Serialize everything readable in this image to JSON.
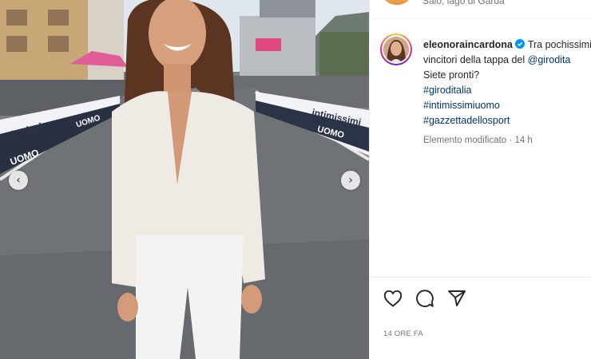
{
  "post": {
    "location": "Salò, lago di Garda",
    "username": "eleonoraincardona",
    "caption_text": "Tra pochissimi vincitori della tappa del",
    "mention": "@girodita",
    "caption_line2": "Siete pronti?",
    "hashtags": [
      "#giroditalia",
      "#intimissimiuomo",
      "#gazzettadellosport"
    ],
    "edited_label": "Elemento modificato",
    "edited_time": "14 h",
    "timestamp": "14 ORE FA"
  },
  "photo": {
    "banner_texts": [
      "imissimi",
      "UOMO",
      "intimissimi",
      "UOMO",
      "UOMO"
    ],
    "prev_glyph": "‹",
    "next_glyph": "›"
  },
  "icons": {
    "like": "heart-icon",
    "comment": "comment-icon",
    "share": "share-icon",
    "verified": "verified-badge-icon",
    "prev": "chevron-left-icon",
    "next": "chevron-right-icon"
  },
  "colors": {
    "link": "#00376b",
    "verified": "#0095f6",
    "muted": "#737373",
    "text": "#262626"
  }
}
